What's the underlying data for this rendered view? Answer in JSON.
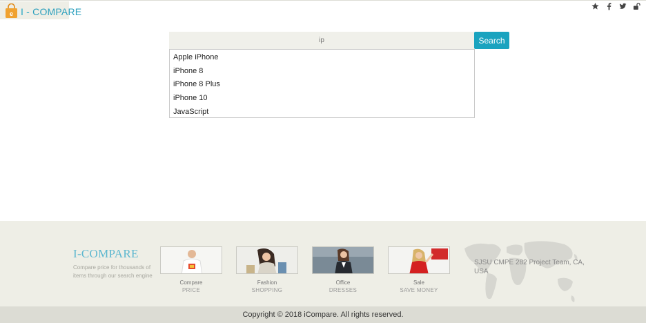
{
  "header": {
    "brand_dash": "I -",
    "brand_word": "COMPARE",
    "icons": [
      "star-icon",
      "facebook-icon",
      "twitter-icon",
      "unlock-icon"
    ],
    "colors": {
      "brand": "#23a6c4",
      "logo_bag": "#f0a230"
    }
  },
  "search": {
    "placeholder": "ip",
    "button_label": "Search",
    "suggestions": [
      "Apple iPhone",
      "iPhone 8",
      "iPhone 8 Plus",
      "iPhone 10",
      "JavaScript"
    ],
    "colors": {
      "button": "#1aa3bf"
    }
  },
  "footer": {
    "brand": "I-COMPARE",
    "description": "Compare price for thousands of items through our search engine",
    "categories": [
      {
        "title": "Compare",
        "subtitle": "PRICE"
      },
      {
        "title": "Fashion",
        "subtitle": "SHOPPING"
      },
      {
        "title": "Office",
        "subtitle": "DRESSES"
      },
      {
        "title": "Sale",
        "subtitle": "SAVE MONEY"
      }
    ],
    "address": "SJSU CMPE 282 Project Team, CA, USA",
    "copyright": "Copyright © 2018 iCompare. All rights reserved."
  }
}
